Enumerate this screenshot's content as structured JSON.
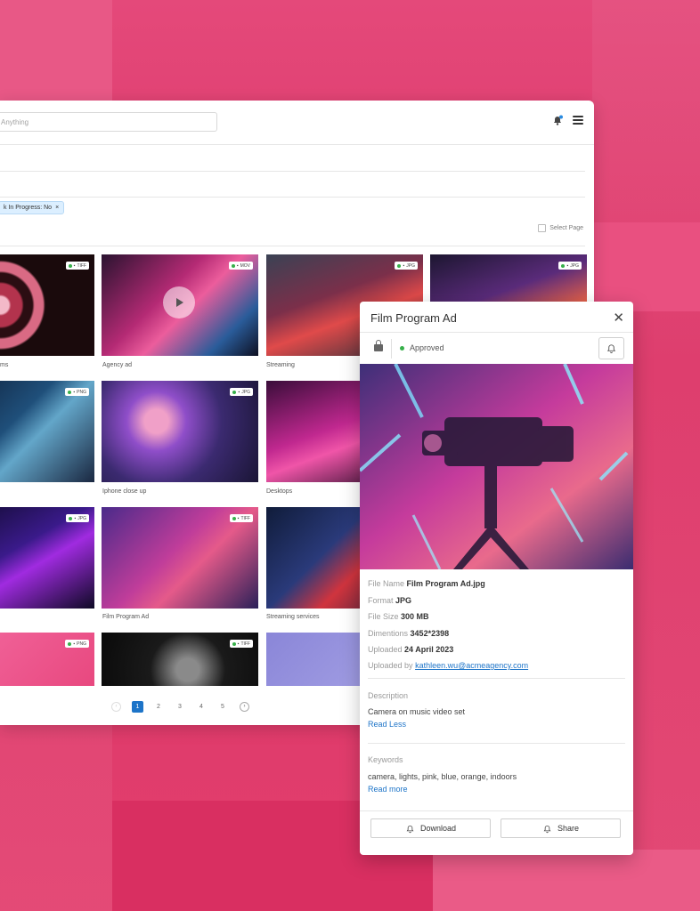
{
  "search": {
    "placeholder": "Anything"
  },
  "filter_chip": {
    "label": "k In Progress: No",
    "remove": "×"
  },
  "select_page": {
    "label": "Select Page"
  },
  "grid": [
    {
      "caption": "ms",
      "format": "TIFF"
    },
    {
      "caption": "Agency ad",
      "format": "MOV"
    },
    {
      "caption": "Streaming",
      "format": "JPG"
    },
    {
      "caption": "",
      "format": "JPG"
    },
    {
      "caption": "",
      "format": "PNG"
    },
    {
      "caption": "Iphone close up",
      "format": "JPG"
    },
    {
      "caption": "Desktops",
      "format": ""
    },
    {
      "caption": "",
      "format": "JPG"
    },
    {
      "caption": "Film Program Ad",
      "format": "TIFF"
    },
    {
      "caption": "Streaming services",
      "format": ""
    },
    {
      "caption": "",
      "format": "PNG"
    },
    {
      "caption": "",
      "format": "TIFF"
    }
  ],
  "pagination": {
    "pages": [
      "1",
      "2",
      "3",
      "4",
      "5"
    ],
    "current": "1"
  },
  "panel": {
    "title": "Film Program Ad",
    "close": "✕",
    "status": "Approved",
    "fields": {
      "file_name_label": "File Name",
      "file_name": "Film Program Ad.jpg",
      "format_label": "Format",
      "format": "JPG",
      "size_label": "File Size",
      "size": "300 MB",
      "dim_label": "Dimentions",
      "dim": "3452*2398",
      "uploaded_label": "Uploaded",
      "uploaded": "24 April 2023",
      "by_label": "Uploaded by",
      "by": "kathleen.wu@acmeagency.com"
    },
    "description_label": "Description",
    "description": "Camera on music video set",
    "read_less": "Read Less",
    "keywords_label": "Keywords",
    "keywords": "camera, lights, pink, blue, orange, indoors",
    "read_more": "Read more",
    "download": "Download",
    "share": "Share"
  },
  "colors": {
    "accent": "#1d74c8",
    "approved": "#37b04a",
    "background": "#dc3466"
  }
}
